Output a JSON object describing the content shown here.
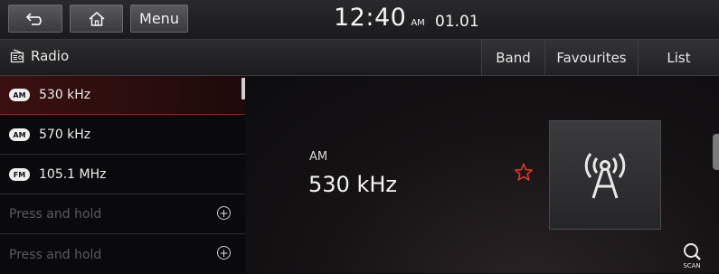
{
  "topbar": {
    "back_icon": "back-arrow-icon",
    "home_icon": "home-icon",
    "menu_label": "Menu",
    "time": "12:40",
    "ampm": "AM",
    "date": "01.01"
  },
  "subbar": {
    "title": "Radio",
    "title_icon": "radio-icon",
    "tabs": [
      "Band",
      "Favourites",
      "List"
    ]
  },
  "presets": [
    {
      "band": "AM",
      "frequency": "530 kHz",
      "selected": true
    },
    {
      "band": "AM",
      "frequency": "570 kHz",
      "selected": false
    },
    {
      "band": "FM",
      "frequency": "105.1 MHz",
      "selected": false
    },
    {
      "placeholder": "Press and hold"
    },
    {
      "placeholder": "Press and hold"
    }
  ],
  "now_playing": {
    "band": "AM",
    "frequency": "530 kHz",
    "favourite_icon": "star-outline-icon",
    "art_icon": "broadcast-antenna-icon"
  },
  "scan": {
    "label": "SCAN",
    "icon": "scan-search-icon"
  },
  "colors": {
    "accent": "#e0342a",
    "selected_row": "#3a1010"
  }
}
